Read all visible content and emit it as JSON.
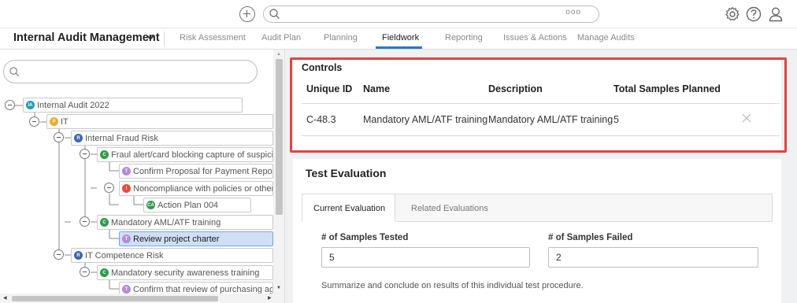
{
  "topbar": {
    "search_more": "ooo"
  },
  "nav": {
    "app_title": "Internal Audit Management",
    "tabs": [
      {
        "label": "Risk Assessment"
      },
      {
        "label": "Audit Plan"
      },
      {
        "label": "Planning"
      },
      {
        "label": "Fieldwork",
        "active": true
      },
      {
        "label": "Reporting"
      },
      {
        "label": "Issues & Actions"
      },
      {
        "label": "Manage Audits"
      }
    ],
    "accent_color": "#2b78c2"
  },
  "tree": {
    "nodes": [
      {
        "badge": "IA",
        "badge_color": "#1f9bb7",
        "label": "Internal Audit 2022",
        "icon": "minus-circle-icon"
      },
      {
        "badge": "P",
        "badge_color": "#f0a82a",
        "label": "IT",
        "icon": "minus-circle-icon"
      },
      {
        "badge": "R",
        "badge_color": "#3b66b2",
        "label": "Internal Fraud Risk",
        "icon": "minus-circle-icon"
      },
      {
        "badge": "C",
        "badge_color": "#2e9a4a",
        "label": "Fraul alert/card blocking capture of suspiciou",
        "icon": "minus-circle-icon"
      },
      {
        "badge": "T",
        "badge_color": "#b48ae0",
        "label": "Confirm Proposal for Payment Report"
      },
      {
        "badge": "!",
        "badge_color": "#e24d3c",
        "label": "Noncompliance with policies or other",
        "icon": "minus-circle-icon"
      },
      {
        "badge": "CA",
        "badge_color": "#2e9a4a",
        "label": "Action Plan 004"
      },
      {
        "badge": "C",
        "badge_color": "#2e9a4a",
        "label": "Mandatory AML/ATF training",
        "icon": "minus-circle-icon"
      },
      {
        "badge": "T",
        "badge_color": "#b48ae0",
        "label": "Review project charter",
        "selected": true
      },
      {
        "badge": "R",
        "badge_color": "#3b66b2",
        "label": "IT Competence Risk",
        "icon": "minus-circle-icon"
      },
      {
        "badge": "C",
        "badge_color": "#2e9a4a",
        "label": "Mandatory security awareness training",
        "icon": "minus-circle-icon"
      },
      {
        "badge": "T",
        "badge_color": "#b48ae0",
        "label": "Confirm that review of purchasing agı"
      }
    ]
  },
  "controls": {
    "title": "Controls",
    "columns": [
      "Unique ID",
      "Name",
      "Description",
      "Total Samples Planned"
    ],
    "rows": [
      {
        "unique_id": "C-48.3",
        "name": "Mandatory AML/ATF training",
        "description": "Mandatory AML/ATF training",
        "total_samples_planned": "5"
      }
    ],
    "highlight_color": "#e04545"
  },
  "test_evaluation": {
    "title": "Test Evaluation",
    "tabs": [
      {
        "label": "Current Evaluation",
        "active": true
      },
      {
        "label": "Related Evaluations"
      }
    ],
    "samples_tested_label": "# of Samples Tested",
    "samples_tested_value": "5",
    "samples_failed_label": "# of Samples Failed",
    "samples_failed_value": "2",
    "help_text": "Summarize and conclude on results of this individual test procedure."
  }
}
